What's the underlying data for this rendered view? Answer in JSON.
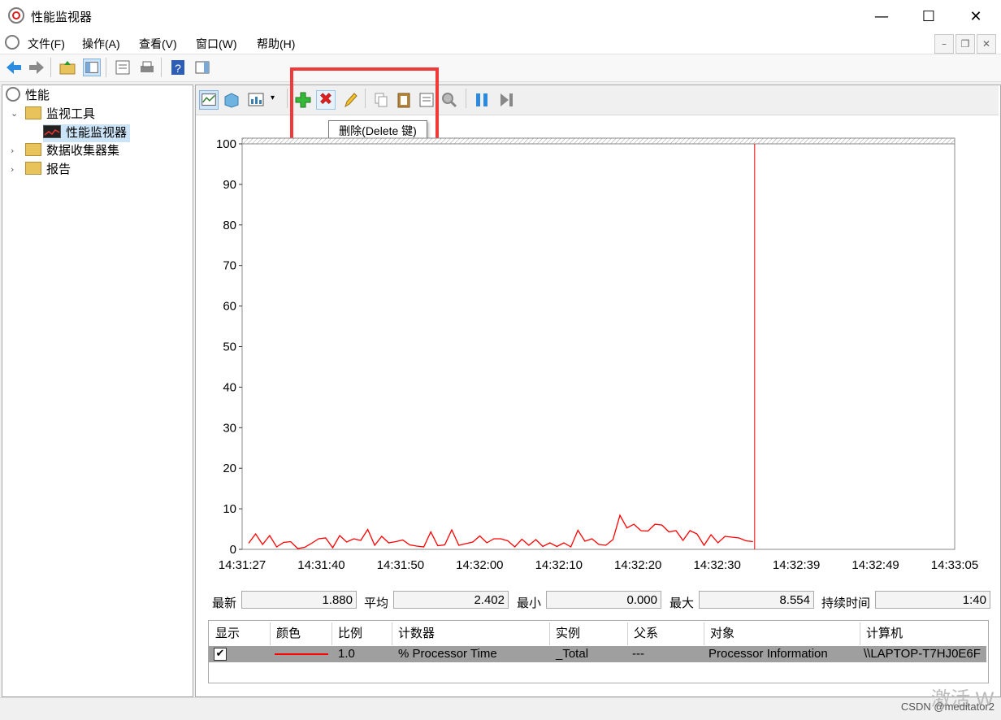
{
  "window": {
    "title": "性能监视器",
    "min": "—",
    "max": "☐",
    "close": "✕"
  },
  "menu": [
    "文件(F)",
    "操作(A)",
    "查看(V)",
    "窗口(W)",
    "帮助(H)"
  ],
  "tree": {
    "root": "性能",
    "children": [
      {
        "label": "监视工具",
        "expanded": true,
        "children": [
          {
            "label": "性能监视器",
            "selected": true
          }
        ]
      },
      {
        "label": "数据收集器集"
      },
      {
        "label": "报告"
      }
    ]
  },
  "tooltip": "删除(Delete 键)",
  "chart_data": {
    "type": "line",
    "ylim": [
      0,
      100
    ],
    "yticks": [
      "100",
      "90",
      "80",
      "70",
      "60",
      "50",
      "40",
      "30",
      "20",
      "10",
      "0"
    ],
    "xticks": [
      "14:31:27",
      "14:31:40",
      "14:31:50",
      "14:32:00",
      "14:32:10",
      "14:32:20",
      "14:32:30",
      "14:32:39",
      "14:32:49",
      "14:33:05"
    ],
    "series": [
      {
        "color": "#ff0000",
        "values": [
          1.5,
          3.8,
          1.2,
          3.4,
          0.6,
          1.7,
          1.9,
          0.2,
          0.5,
          1.5,
          2.6,
          2.8,
          0.4,
          3.4,
          1.8,
          2.6,
          2.2,
          4.9,
          1.0,
          3.2,
          1.6,
          1.9,
          2.3,
          1.1,
          0.8,
          0.6,
          4.3,
          0.9,
          1.1,
          4.8,
          1.0,
          1.4,
          1.8,
          3.3,
          1.6,
          2.6,
          2.6,
          2.1,
          0.6,
          2.5,
          1.0,
          2.4,
          0.7,
          1.6,
          0.7,
          1.6,
          0.6,
          4.7,
          2.0,
          2.6,
          1.2,
          1.0,
          2.4,
          8.4,
          5.3,
          6.2,
          4.6,
          4.5,
          6.2,
          6.0,
          4.3,
          4.6,
          2.2,
          4.6,
          3.8,
          1.0,
          3.6,
          1.6,
          3.2,
          3.0,
          2.8,
          2.1,
          1.9
        ]
      }
    ],
    "cursor_fraction": 0.717
  },
  "stats": {
    "last_label": "最新",
    "last": "1.880",
    "avg_label": "平均",
    "avg": "2.402",
    "min_label": "最小",
    "min": "0.000",
    "max_label": "最大",
    "max": "8.554",
    "dur_label": "持续时间",
    "dur": "1:40"
  },
  "table": {
    "headers": [
      "显示",
      "颜色",
      "比例",
      "计数器",
      "实例",
      "父系",
      "对象",
      "计算机"
    ],
    "row": {
      "scale": "1.0",
      "counter": "% Processor Time",
      "instance": "_Total",
      "parent": "---",
      "object": "Processor Information",
      "computer": "\\\\LAPTOP-T7HJ0E6F"
    }
  },
  "watermark": "CSDN @meditator2",
  "watermark_bg": "激活 W"
}
